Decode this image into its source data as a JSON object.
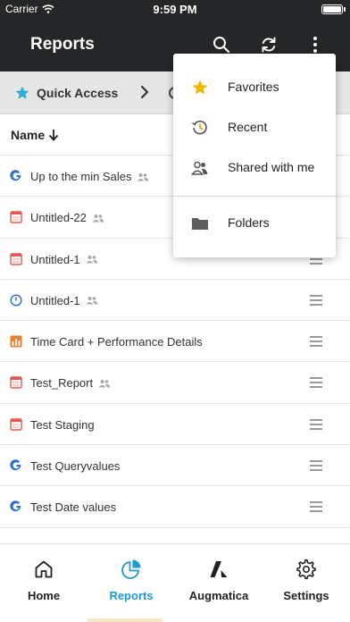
{
  "status_bar": {
    "carrier": "Carrier",
    "time": "9:59 PM"
  },
  "header": {
    "title": "Reports"
  },
  "quick_access": {
    "label": "Quick Access"
  },
  "list_header": {
    "sort_label": "Name"
  },
  "reports": [
    {
      "name": "Up to the min Sales",
      "icon": "google-analytics-icon",
      "shared": true
    },
    {
      "name": "Untitled-22",
      "icon": "calendar-report-icon",
      "shared": true
    },
    {
      "name": "Untitled-1",
      "icon": "calendar-report-icon",
      "shared": true
    },
    {
      "name": "Untitled-1",
      "icon": "clock-report-icon",
      "shared": true
    },
    {
      "name": "Time Card + Performance Details",
      "icon": "bar-chart-report-icon",
      "shared": false
    },
    {
      "name": "Test_Report",
      "icon": "calendar-report-icon",
      "shared": true
    },
    {
      "name": "Test Staging",
      "icon": "calendar-report-icon",
      "shared": false
    },
    {
      "name": "Test Queryvalues",
      "icon": "google-analytics-icon",
      "shared": false
    },
    {
      "name": "Test Date values",
      "icon": "google-analytics-icon",
      "shared": false
    }
  ],
  "menu": {
    "items": [
      {
        "label": "Favorites",
        "icon": "star-icon"
      },
      {
        "label": "Recent",
        "icon": "history-icon"
      },
      {
        "label": "Shared with me",
        "icon": "shared-users-icon"
      },
      {
        "label": "Folders",
        "icon": "folder-icon"
      }
    ]
  },
  "tabs": [
    {
      "label": "Home",
      "icon": "home-icon",
      "active": false
    },
    {
      "label": "Reports",
      "icon": "pie-chart-icon",
      "active": true
    },
    {
      "label": "Augmatica",
      "icon": "augmatica-logo-icon",
      "active": false
    },
    {
      "label": "Settings",
      "icon": "gear-icon",
      "active": false
    }
  ],
  "colors": {
    "header_bg": "#242628",
    "accent": "#1a9bd7",
    "star": "#f2b600",
    "report_red": "#e8574f",
    "google_blue": "#2f6fc6"
  }
}
